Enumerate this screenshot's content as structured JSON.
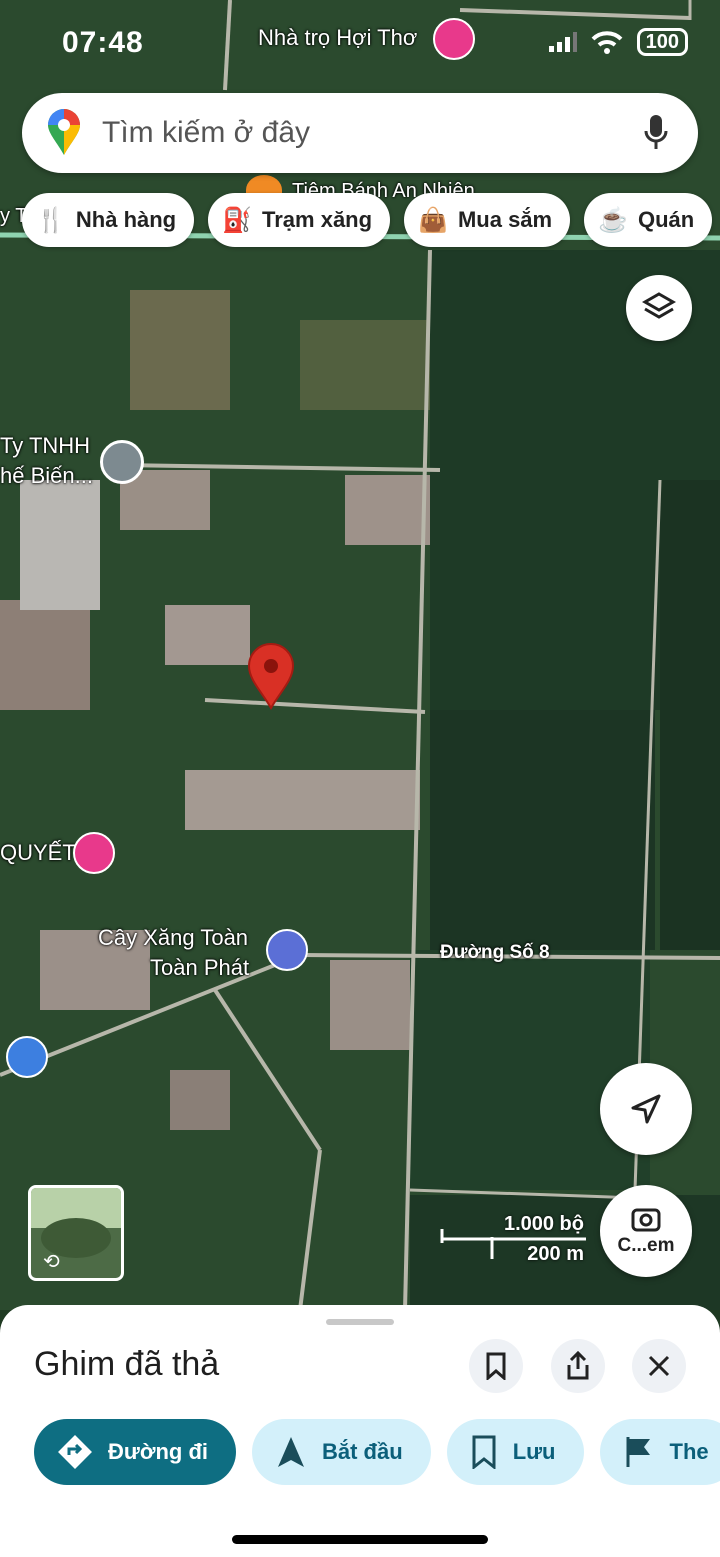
{
  "status_bar": {
    "time": "07:48",
    "battery": "100"
  },
  "search": {
    "placeholder": "Tìm kiếm ở đây"
  },
  "chips": [
    {
      "label": "Nhà hàng",
      "icon": "fork-knife-icon"
    },
    {
      "label": "Trạm xăng",
      "icon": "gas-pump-icon"
    },
    {
      "label": "Mua sắm",
      "icon": "shopping-bag-icon"
    },
    {
      "label": "Quán",
      "icon": "cup-icon"
    }
  ],
  "map_labels": {
    "hotel_top": "Nhà trọ Hợi Thơ",
    "bakery": "Tiệm Bánh An Nhiên",
    "company_line1": "Ty TNHH",
    "company_line2": "hế Biến...",
    "left_hotel": "QUYẾT",
    "gas_line1": "Cây Xăng Toàn",
    "gas_line2": "Toàn Phát",
    "road": "Đường Số 8",
    "partial_left": "y T"
  },
  "scale": {
    "imperial": "1.000 bộ",
    "metric": "200 m"
  },
  "camera_label": "C...em",
  "sheet": {
    "title": "Ghim đã thả",
    "actions": [
      {
        "label": "Đường đi",
        "icon": "directions-icon"
      },
      {
        "label": "Bắt đầu",
        "icon": "navigation-arrow-icon"
      },
      {
        "label": "Lưu",
        "icon": "bookmark-icon"
      },
      {
        "label": "The",
        "icon": "flag-icon"
      }
    ]
  },
  "colors": {
    "primary": "#0e6e82",
    "chip_bg": "#d3f0fa",
    "pin": "#d93025",
    "hotel_pin": "#e8398b"
  }
}
